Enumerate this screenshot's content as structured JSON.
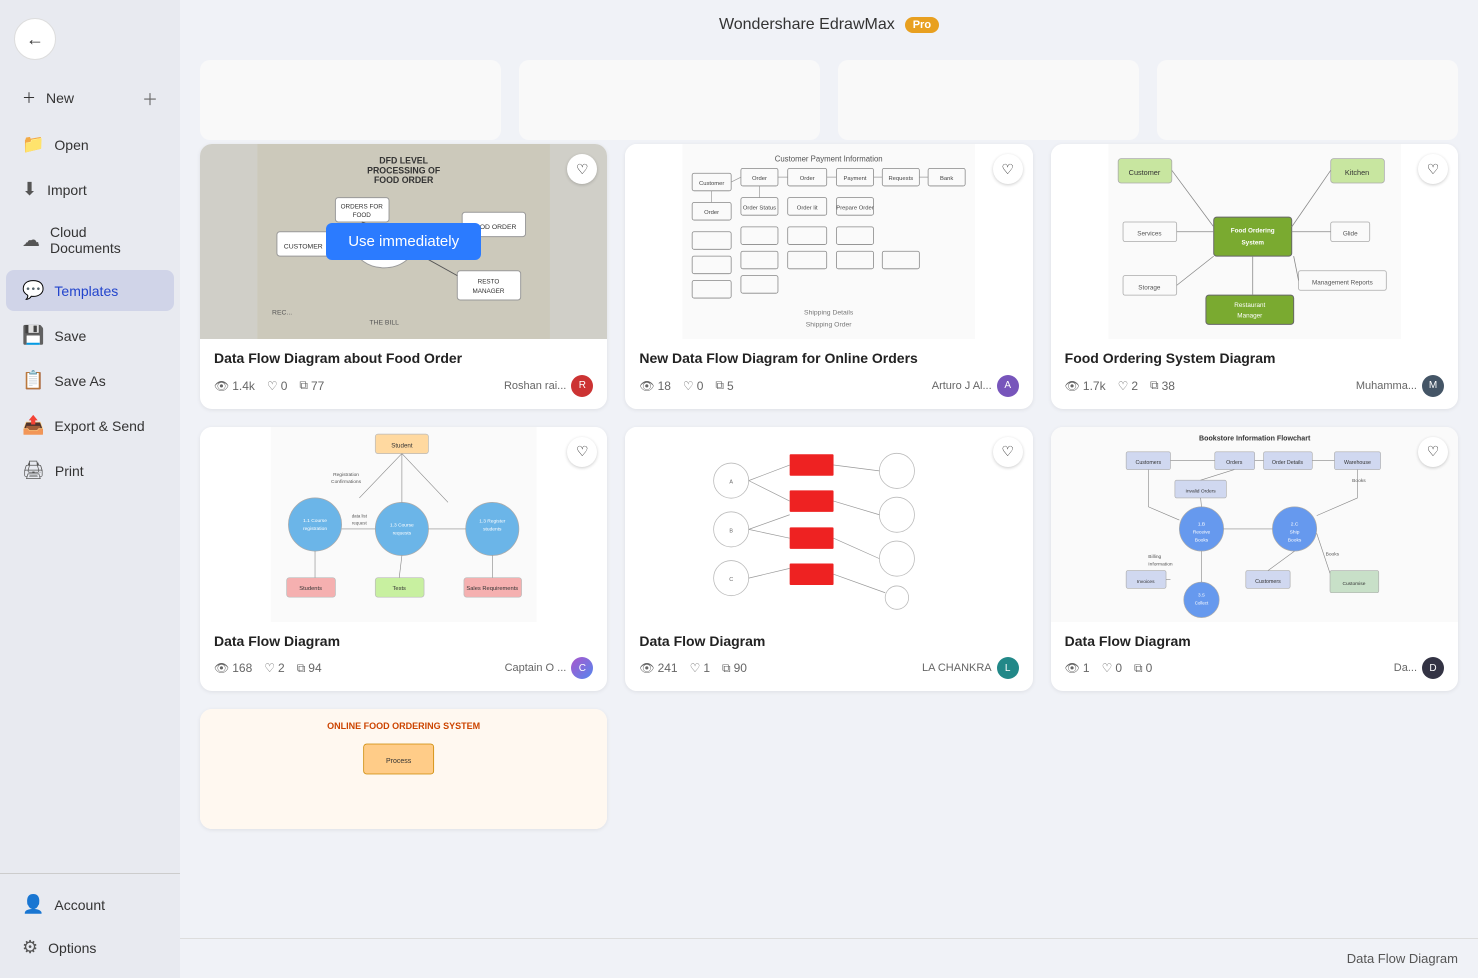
{
  "app": {
    "title": "Wondershare EdrawMax",
    "pro_label": "Pro"
  },
  "sidebar": {
    "back_label": "←",
    "items": [
      {
        "id": "new",
        "label": "New",
        "icon": "➕"
      },
      {
        "id": "open",
        "label": "Open",
        "icon": "📁"
      },
      {
        "id": "import",
        "label": "Import",
        "icon": "⬇️"
      },
      {
        "id": "cloud",
        "label": "Cloud Documents",
        "icon": "☁️"
      },
      {
        "id": "templates",
        "label": "Templates",
        "icon": "💬"
      },
      {
        "id": "save",
        "label": "Save",
        "icon": "💾"
      },
      {
        "id": "saveas",
        "label": "Save As",
        "icon": "📋"
      },
      {
        "id": "export",
        "label": "Export & Send",
        "icon": "📤"
      },
      {
        "id": "print",
        "label": "Print",
        "icon": "🖨️"
      }
    ],
    "bottom_items": [
      {
        "id": "account",
        "label": "Account",
        "icon": "👤"
      },
      {
        "id": "options",
        "label": "Options",
        "icon": "⚙️"
      }
    ]
  },
  "cards": [
    {
      "id": "card1",
      "title": "Data Flow Diagram about Food Order",
      "views": "1.4k",
      "likes": "0",
      "copies": "77",
      "author": "Roshan rai...",
      "author_color": "#cc3333",
      "author_initial": "R",
      "hovered": true,
      "use_btn": true
    },
    {
      "id": "card2",
      "title": "New Data Flow Diagram for Online Orders",
      "views": "18",
      "likes": "0",
      "copies": "5",
      "author": "Arturo J Al...",
      "author_color": "#7755bb",
      "author_initial": "A"
    },
    {
      "id": "card3",
      "title": "Food Ordering System Diagram",
      "views": "1.7k",
      "likes": "2",
      "copies": "38",
      "author": "Muhamma...",
      "author_color": "#556677",
      "author_initial": "M"
    },
    {
      "id": "card4",
      "title": "Data Flow Diagram",
      "views": "168",
      "likes": "2",
      "copies": "94",
      "author": "Captain O ...",
      "author_color": "#aa5500",
      "author_initial": "C"
    },
    {
      "id": "card5",
      "title": "Data Flow Diagram",
      "views": "241",
      "likes": "1",
      "copies": "90",
      "author": "LA CHANKRA",
      "author_color": "#114488",
      "author_initial": "L"
    },
    {
      "id": "card6",
      "title": "Data Flow Diagram",
      "views": "1",
      "likes": "0",
      "copies": "0",
      "author": "Da...",
      "author_color": "#334455",
      "author_initial": "D"
    }
  ],
  "footer": {
    "label": "Data Flow Diagram"
  },
  "use_immediately": "Use immediately"
}
